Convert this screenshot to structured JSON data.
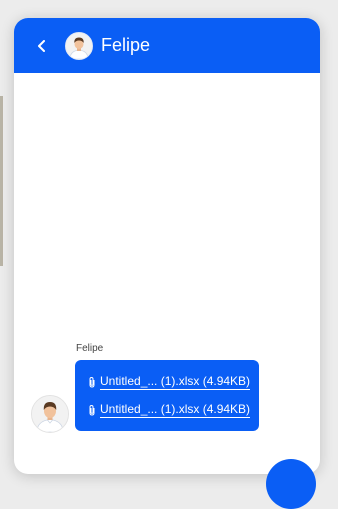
{
  "header": {
    "contact_name": "Felipe"
  },
  "conversation": {
    "sender_name": "Felipe",
    "attachments": [
      {
        "label": "Untitled_... (1).xlsx (4.94KB)"
      },
      {
        "label": "Untitled_... (1).xlsx (4.94KB)"
      }
    ]
  },
  "icons": {
    "back": "chevron-left-icon",
    "attachment": "paperclip-icon"
  },
  "colors": {
    "accent": "#0a5ef5",
    "panel": "#ffffff",
    "background": "#ececec"
  }
}
